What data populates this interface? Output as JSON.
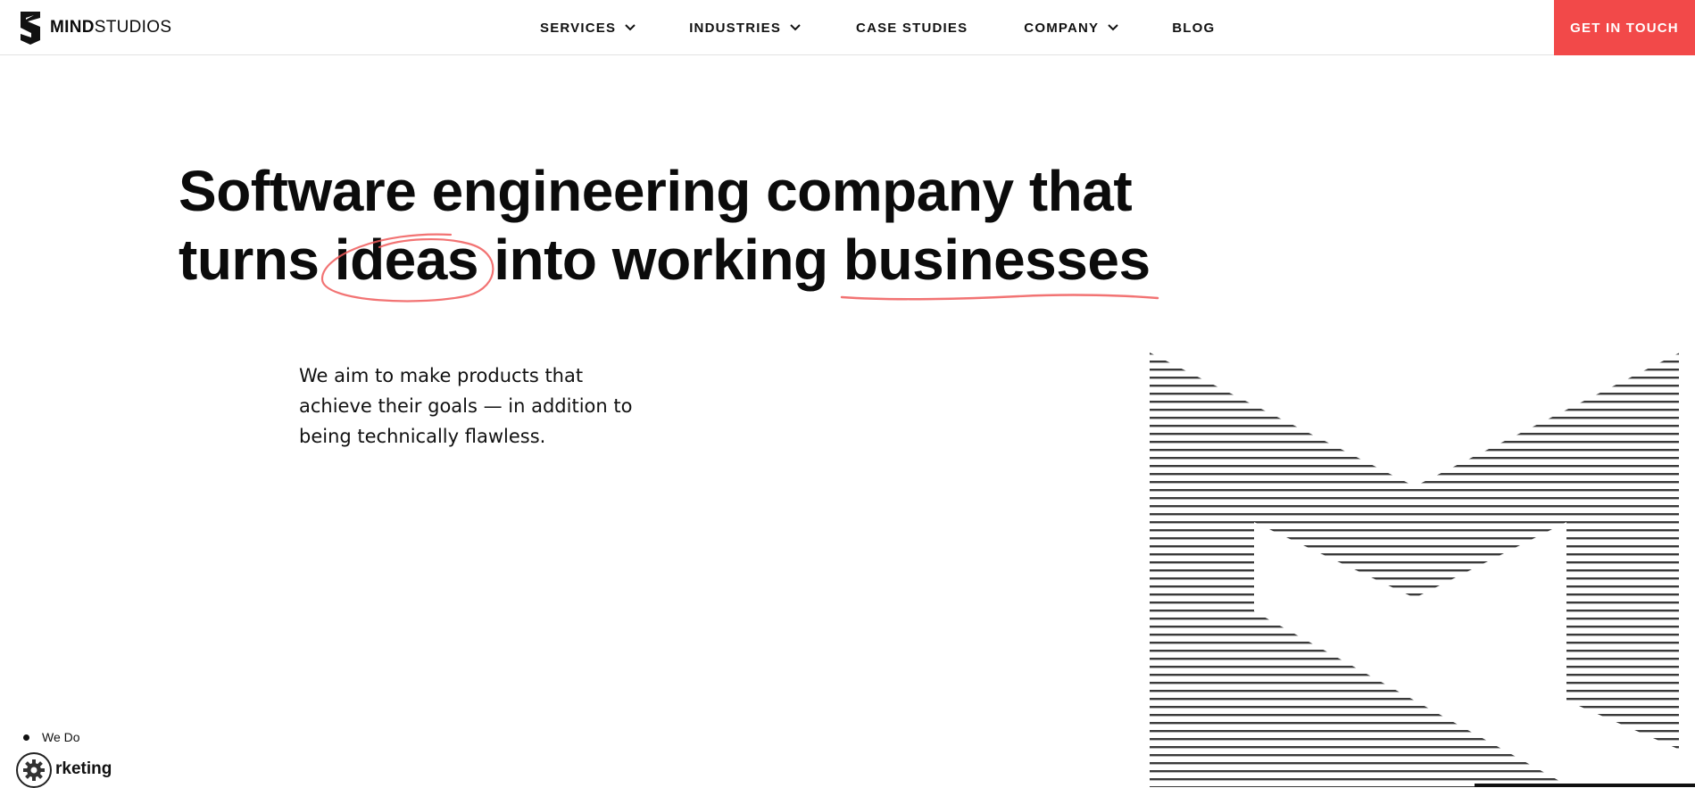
{
  "brand": {
    "name_bold": "MIND",
    "name_light": "STUDIOS",
    "icon": "mindstudios-logo-icon"
  },
  "nav": {
    "items": [
      {
        "label": "SERVICES",
        "has_dropdown": true
      },
      {
        "label": "INDUSTRIES",
        "has_dropdown": true
      },
      {
        "label": "CASE STUDIES",
        "has_dropdown": false
      },
      {
        "label": "COMPANY",
        "has_dropdown": true
      },
      {
        "label": "BLOG",
        "has_dropdown": false
      }
    ],
    "dropdown_icon": "chevron-down-icon",
    "cta_label": "GET IN TOUCH"
  },
  "hero": {
    "line1": "Software engineering company that",
    "line2_part1": "turns ",
    "line2_circled": "ideas",
    "line2_part2": " into working ",
    "line2_underlined": "businesses",
    "subtitle": "We aim to make products that achieve their goals — in addition to being technically flawless."
  },
  "bottom": {
    "section_label": "We Do",
    "partial_word": "rketing",
    "settings_icon": "gear-icon"
  },
  "colors": {
    "accent": "#f24949",
    "text": "#0b0b0b",
    "stripe": "#3a3a3a",
    "divider": "#e3e3e3"
  }
}
